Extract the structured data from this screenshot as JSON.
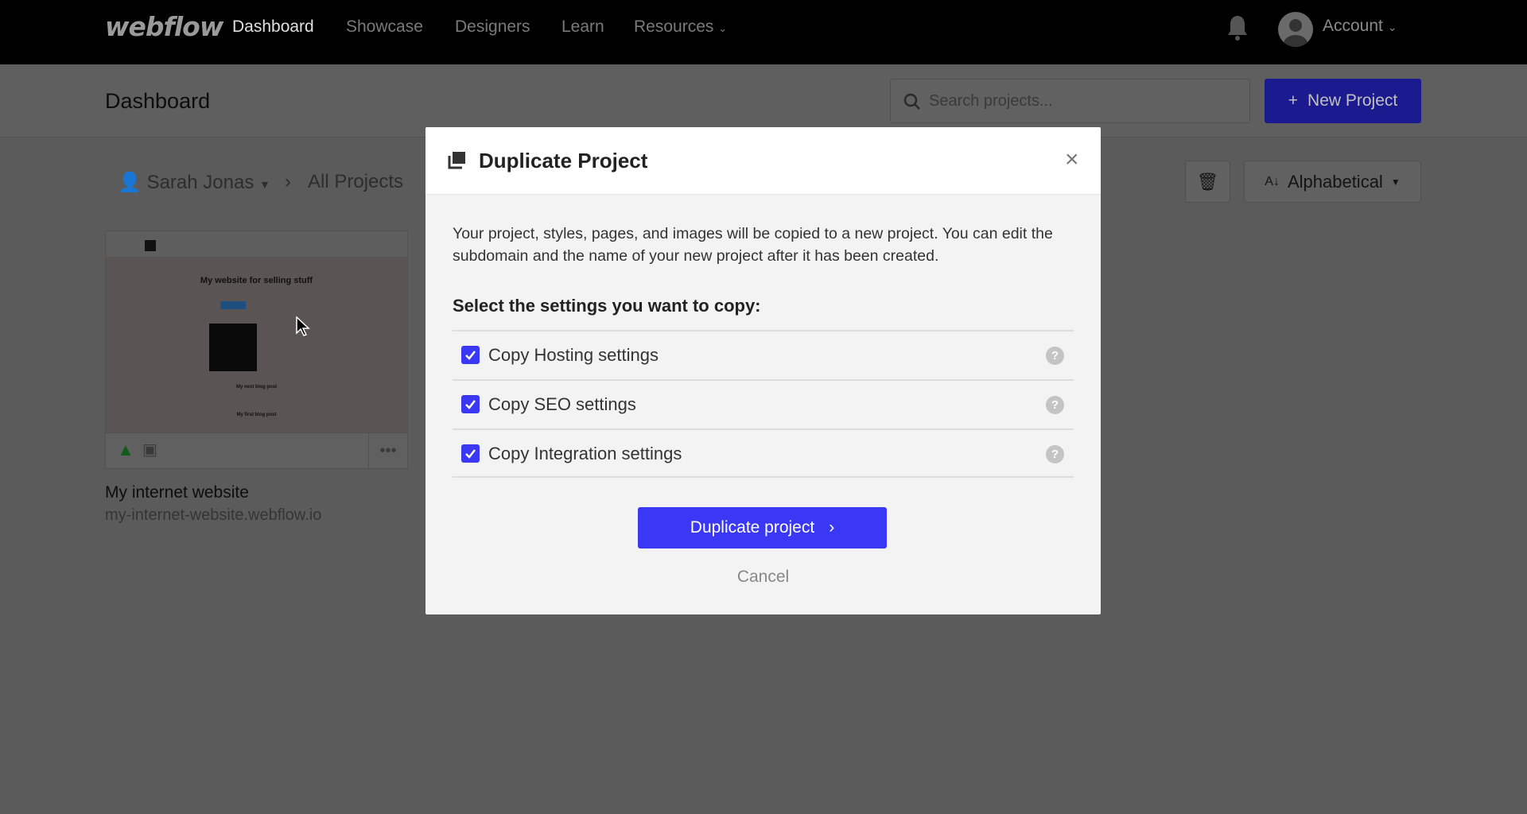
{
  "nav": {
    "logo": "webflow",
    "items": [
      "Dashboard",
      "Showcase",
      "Designers",
      "Learn",
      "Resources"
    ],
    "account": "Account"
  },
  "header": {
    "title": "Dashboard",
    "search_placeholder": "Search projects...",
    "new_project": "New Project"
  },
  "toolbar": {
    "user": "Sarah Jonas",
    "folder": "All Projects",
    "sort": "Alphabetical"
  },
  "project": {
    "title": "My internet website",
    "url": "my-internet-website.webflow.io",
    "preview_heading": "My website for selling stuff",
    "preview_posts": [
      "My next blog post",
      "My first blog post"
    ]
  },
  "modal": {
    "title": "Duplicate Project",
    "description": "Your project, styles, pages, and images will be copied to a new project. You can edit the subdomain and the name of your new project after it has been created.",
    "select_label": "Select the settings you want to copy:",
    "options": [
      {
        "label": "Copy Hosting settings",
        "checked": true
      },
      {
        "label": "Copy SEO settings",
        "checked": true
      },
      {
        "label": "Copy Integration settings",
        "checked": true
      }
    ],
    "confirm": "Duplicate project",
    "cancel": "Cancel"
  },
  "colors": {
    "accent": "#3b38f5",
    "nav_bg": "#000000"
  }
}
